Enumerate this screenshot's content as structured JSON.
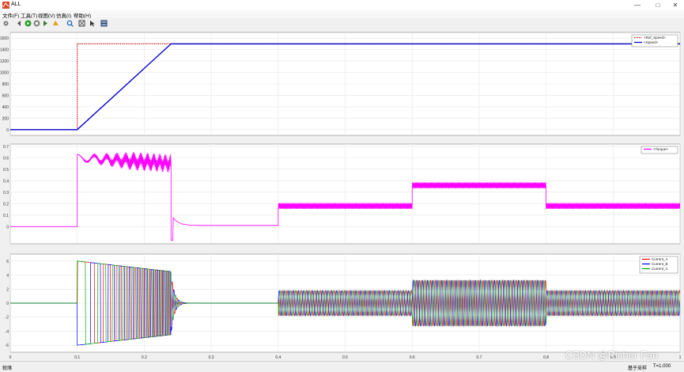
{
  "window": {
    "title": "ALL",
    "minimize": "—",
    "maximize": "□",
    "close": "✕"
  },
  "menu": [
    "文件(F)",
    "工具(T)",
    "视图(V)",
    "仿真(I)",
    "帮助(H)"
  ],
  "toolbar_icons": [
    "settings-icon",
    "back-icon",
    "run-icon",
    "stop-icon",
    "step-icon",
    "highlight-icon",
    "zoom-icon",
    "autoscale-icon",
    "cursor-icon",
    "layout-icon"
  ],
  "status": {
    "left": "就绪",
    "sample": "基于采样",
    "time": "T=1.000"
  },
  "watermark": "CSDN @Richer Fan",
  "colors": {
    "ref_speed": "#cc0000",
    "speed": "#0000cc",
    "torque": "#ff00ff",
    "current_a": "#ff0000",
    "current_b": "#0000ff",
    "current_c": "#00aa00"
  },
  "chart_data": [
    {
      "type": "line",
      "xlim": [
        0,
        1
      ],
      "ylim": [
        -100,
        1700
      ],
      "yticks": [
        "0",
        "200",
        "400",
        "600",
        "800",
        "1000",
        "1200",
        "1400",
        "1600"
      ],
      "legend": {
        "placement": "top-right",
        "entries": [
          "<Ref_Speed>",
          "<Speed>"
        ]
      },
      "grid": true,
      "series": [
        {
          "name": "<Ref_Speed>",
          "style": "dotted",
          "x": [
            0,
            0.1,
            0.1,
            1.0
          ],
          "y": [
            0,
            0,
            1500,
            1500
          ]
        },
        {
          "name": "<Speed>",
          "style": "solid",
          "x": [
            0,
            0.1,
            0.24,
            1.0
          ],
          "y": [
            0,
            0,
            1500,
            1500
          ]
        }
      ]
    },
    {
      "type": "line",
      "xlim": [
        0,
        1
      ],
      "ylim": [
        -0.15,
        0.72
      ],
      "yticks": [
        "0",
        "0.1",
        "0.2",
        "0.3",
        "0.4",
        "0.5",
        "0.6",
        "0.7"
      ],
      "legend": {
        "placement": "top-right",
        "entries": [
          "<Torque>"
        ]
      },
      "grid": true,
      "series": [
        {
          "name": "<Torque>",
          "segments": [
            {
              "x0": 0,
              "x1": 0.1,
              "level": 0,
              "ripple": 0
            },
            {
              "x0": 0.1,
              "x1": 0.24,
              "level": 0.6,
              "ripple": 0.05
            },
            {
              "x0": 0.24,
              "x1": 0.4,
              "level": 0.01,
              "ripple": 0
            },
            {
              "x0": 0.4,
              "x1": 0.6,
              "level": 0.18,
              "ripple": 0.025
            },
            {
              "x0": 0.6,
              "x1": 0.8,
              "level": 0.36,
              "ripple": 0.025
            },
            {
              "x0": 0.8,
              "x1": 1.0,
              "level": 0.18,
              "ripple": 0.025
            }
          ]
        }
      ]
    },
    {
      "type": "line",
      "xlim": [
        0,
        1
      ],
      "ylim": [
        -7,
        7
      ],
      "yticks": [
        "-6",
        "-4",
        "-2",
        "0",
        "2",
        "4",
        "6"
      ],
      "xticks": [
        "0",
        "0.1",
        "0.2",
        "0.3",
        "0.4",
        "0.5",
        "0.6",
        "0.7",
        "0.8",
        "0.9",
        "1"
      ],
      "legend": {
        "placement": "top-right",
        "entries": [
          "Current_A",
          "Current_B",
          "Current_C"
        ]
      },
      "grid": true,
      "series": [
        {
          "name": "Current_A"
        },
        {
          "name": "Current_B"
        },
        {
          "name": "Current_C"
        }
      ],
      "amplitude_envelope": [
        {
          "x0": 0.1,
          "x1": 0.24,
          "amp_start": 6,
          "amp_end": 4.5
        },
        {
          "x0": 0.24,
          "x1": 0.4,
          "amp_start": 0,
          "amp_end": 0
        },
        {
          "x0": 0.4,
          "x1": 0.6,
          "amp_start": 1.8,
          "amp_end": 1.8
        },
        {
          "x0": 0.6,
          "x1": 0.8,
          "amp_start": 3.3,
          "amp_end": 3.3
        },
        {
          "x0": 0.8,
          "x1": 1.0,
          "amp_start": 1.8,
          "amp_end": 1.8
        }
      ]
    }
  ]
}
